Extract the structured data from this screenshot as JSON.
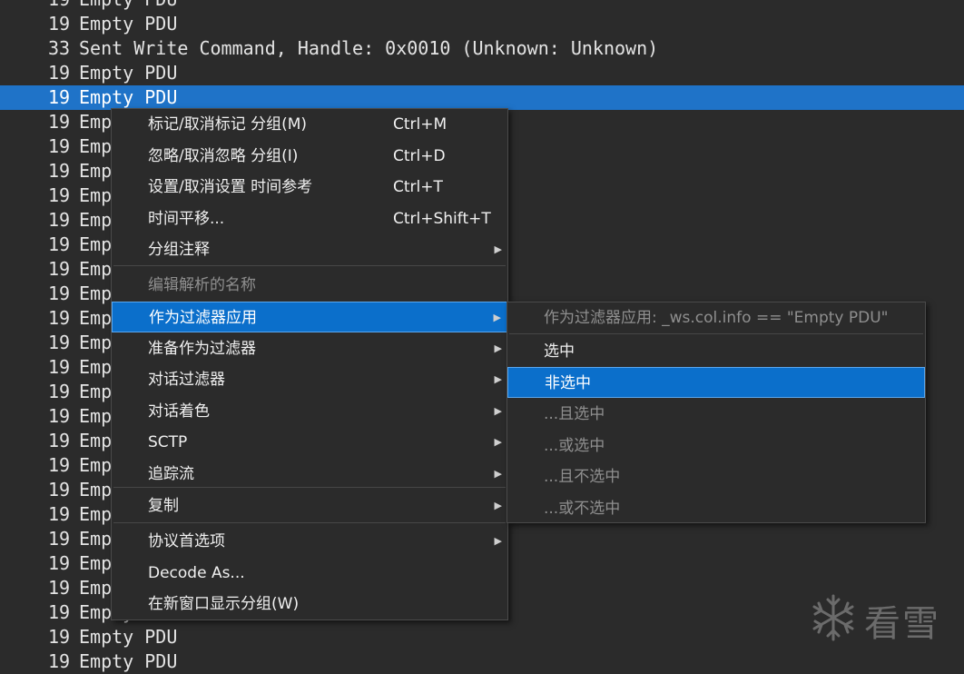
{
  "packet_rows": [
    {
      "len": "19",
      "info": "Empty PDU",
      "selected": false
    },
    {
      "len": "19",
      "info": "Empty PDU",
      "selected": false
    },
    {
      "len": "33",
      "info": "Sent Write Command, Handle: 0x0010 (Unknown: Unknown)",
      "selected": false
    },
    {
      "len": "19",
      "info": "Empty PDU",
      "selected": false
    },
    {
      "len": "19",
      "info": "Empty PDU",
      "selected": true
    },
    {
      "len": "19",
      "info": "Empty PDU",
      "selected": false
    },
    {
      "len": "19",
      "info": "Empty PDU",
      "selected": false
    },
    {
      "len": "19",
      "info": "Empty PDU",
      "selected": false
    },
    {
      "len": "19",
      "info": "Empty PDU",
      "selected": false
    },
    {
      "len": "19",
      "info": "Empty PDU",
      "selected": false
    },
    {
      "len": "19",
      "info": "Empty PDU",
      "selected": false
    },
    {
      "len": "19",
      "info": "Empty PDU",
      "selected": false
    },
    {
      "len": "19",
      "info": "Empty PDU",
      "selected": false
    },
    {
      "len": "19",
      "info": "Empty PDU",
      "selected": false
    },
    {
      "len": "19",
      "info": "Empty PDU",
      "selected": false
    },
    {
      "len": "19",
      "info": "Empty PDU",
      "selected": false
    },
    {
      "len": "19",
      "info": "Empty PDU",
      "selected": false
    },
    {
      "len": "19",
      "info": "Empty PDU",
      "selected": false
    },
    {
      "len": "19",
      "info": "Empty PDU",
      "selected": false
    },
    {
      "len": "19",
      "info": "Empty PDU",
      "selected": false
    },
    {
      "len": "19",
      "info": "Empty PDU",
      "selected": false
    },
    {
      "len": "19",
      "info": "Empty PDU",
      "selected": false
    },
    {
      "len": "19",
      "info": "Empty PDU",
      "selected": false
    },
    {
      "len": "19",
      "info": "Empty PDU",
      "selected": false
    },
    {
      "len": "19",
      "info": "Empty PDU",
      "selected": false
    },
    {
      "len": "19",
      "info": "Empty PDU",
      "selected": false
    },
    {
      "len": "19",
      "info": "Empty PDU",
      "selected": false
    },
    {
      "len": "19",
      "info": "Empty PDU",
      "selected": false
    }
  ],
  "context_menu": {
    "items": [
      {
        "label": "标记/取消标记 分组(M)",
        "shortcut": "Ctrl+M"
      },
      {
        "label": "忽略/取消忽略 分组(I)",
        "shortcut": "Ctrl+D"
      },
      {
        "label": "设置/取消设置 时间参考",
        "shortcut": "Ctrl+T"
      },
      {
        "label": "时间平移...",
        "shortcut": "Ctrl+Shift+T"
      },
      {
        "label": "分组注释",
        "submenu": true
      },
      {
        "label": "编辑解析的名称",
        "disabled": true
      },
      {
        "label": "作为过滤器应用",
        "submenu": true,
        "highlight": true
      },
      {
        "label": "准备作为过滤器",
        "submenu": true
      },
      {
        "label": "对话过滤器",
        "submenu": true
      },
      {
        "label": "对话着色",
        "submenu": true
      },
      {
        "label": "SCTP",
        "submenu": true
      },
      {
        "label": "追踪流",
        "submenu": true
      },
      {
        "label": "复制",
        "submenu": true
      },
      {
        "label": "协议首选项",
        "submenu": true
      },
      {
        "label": "Decode As..."
      },
      {
        "label": "在新窗口显示分组(W)"
      }
    ]
  },
  "submenu": {
    "items": [
      {
        "label": "作为过滤器应用: _ws.col.info == \"Empty PDU\"",
        "disabled": true
      },
      {
        "label": "选中"
      },
      {
        "label": "非选中",
        "highlight": true
      },
      {
        "label": "...且选中",
        "disabled": true
      },
      {
        "label": "...或选中",
        "disabled": true
      },
      {
        "label": "...且不选中",
        "disabled": true
      },
      {
        "label": "...或不选中",
        "disabled": true
      }
    ]
  },
  "watermark": {
    "text": "看雪",
    "icon": "snowflake-icon"
  },
  "colors": {
    "selection": "#1f73c8",
    "menu_highlight": "#0b6fcb",
    "background": "#2b2b2b"
  }
}
